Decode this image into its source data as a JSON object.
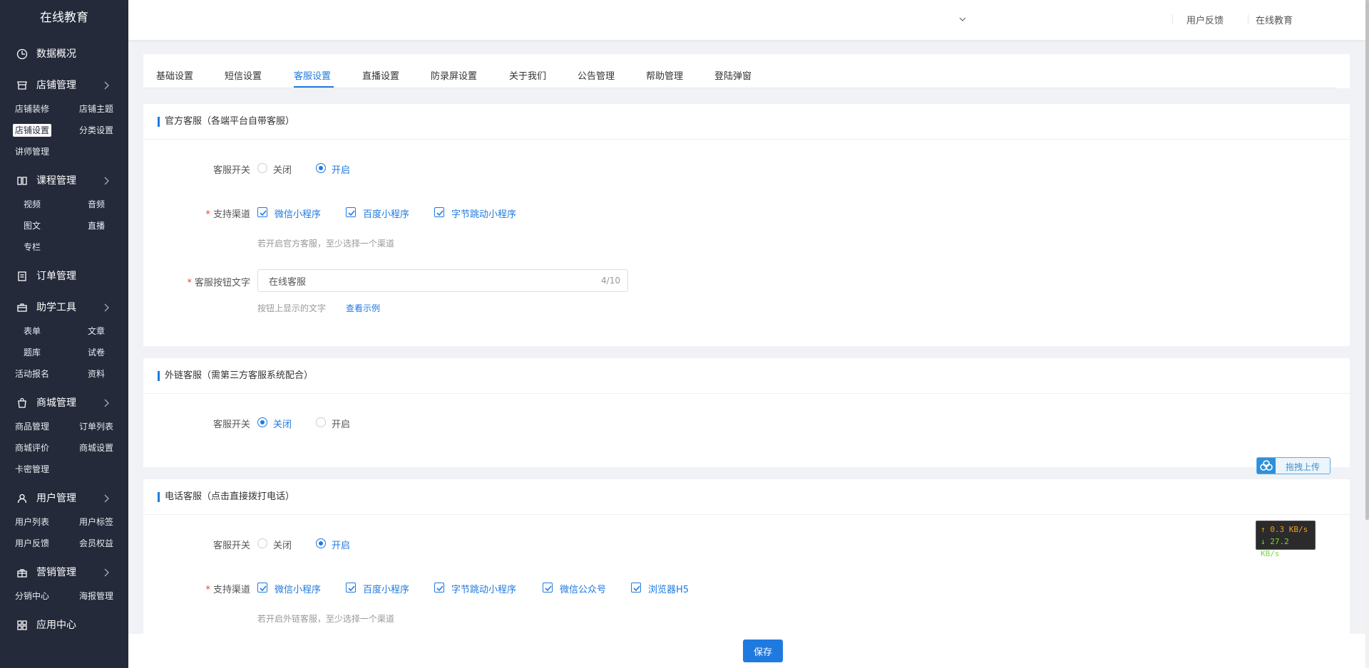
{
  "app": {
    "brand": "在线教育"
  },
  "header": {
    "feedback": "用户反馈",
    "account": "在线教育"
  },
  "sidebar": {
    "overview": "数据概况",
    "groups": [
      {
        "label": "店铺管理",
        "icon": "store-icon",
        "items": [
          "店铺装修",
          "店铺主题",
          "店铺设置",
          "分类设置",
          "讲师管理"
        ],
        "active": "店铺设置"
      },
      {
        "label": "课程管理",
        "icon": "book-icon",
        "items": [
          "视频",
          "音频",
          "图文",
          "直播",
          "专栏"
        ]
      },
      {
        "label": "订单管理",
        "icon": "order-icon",
        "items": []
      },
      {
        "label": "助学工具",
        "icon": "toolbox-icon",
        "items": [
          "表单",
          "文章",
          "题库",
          "试卷",
          "活动报名",
          "资料"
        ]
      },
      {
        "label": "商城管理",
        "icon": "bag-icon",
        "items": [
          "商品管理",
          "订单列表",
          "商城评价",
          "商城设置",
          "卡密管理"
        ]
      },
      {
        "label": "用户管理",
        "icon": "user-icon",
        "items": [
          "用户列表",
          "用户标签",
          "用户反馈",
          "会员权益"
        ]
      },
      {
        "label": "营销管理",
        "icon": "gift-icon",
        "items": [
          "分销中心",
          "海报管理"
        ]
      },
      {
        "label": "应用中心",
        "icon": "app-icon",
        "items": []
      }
    ]
  },
  "tabs": {
    "items": [
      "基础设置",
      "短信设置",
      "客服设置",
      "直播设置",
      "防录屏设置",
      "关于我们",
      "公告管理",
      "帮助管理",
      "登陆弹窗"
    ],
    "active": "客服设置"
  },
  "official": {
    "title": "官方客服（各端平台自带客服）",
    "switch_label": "客服开关",
    "off": "关闭",
    "on": "开启",
    "switch_value": "开启",
    "channels_label": "支持渠道",
    "channels": [
      {
        "label": "微信小程序",
        "checked": true
      },
      {
        "label": "百度小程序",
        "checked": true
      },
      {
        "label": "字节跳动小程序",
        "checked": true
      }
    ],
    "channels_hint": "若开启官方客服，至少选择一个渠道",
    "button_text_label": "客服按钮文字",
    "button_text_value": "在线客服",
    "button_text_count": "4/10",
    "button_text_hint": "按钮上显示的文字",
    "example_link": "查看示例"
  },
  "external": {
    "title": "外链客服（需第三方客服系统配合）",
    "switch_label": "客服开关",
    "off": "关闭",
    "on": "开启",
    "switch_value": "关闭"
  },
  "phone": {
    "title": "电话客服（点击直接拨打电话）",
    "switch_label": "客服开关",
    "off": "关闭",
    "on": "开启",
    "switch_value": "开启",
    "channels_label": "支持渠道",
    "channels": [
      {
        "label": "微信小程序",
        "checked": true
      },
      {
        "label": "百度小程序",
        "checked": true
      },
      {
        "label": "字节跳动小程序",
        "checked": true
      },
      {
        "label": "微信公众号",
        "checked": true
      },
      {
        "label": "浏览器H5",
        "checked": true
      }
    ],
    "channels_hint": "若开启外链客服，至少选择一个渠道"
  },
  "widgets": {
    "upload_text": "拖拽上传",
    "speed_up": "↑ 0.3 KB/s",
    "speed_down": "↓ 27.2 KB/s"
  },
  "actions": {
    "save": "保存"
  },
  "colors": {
    "accent": "#1f7ae0",
    "sidebar_bg": "#242a3a",
    "required": "#f04134"
  }
}
